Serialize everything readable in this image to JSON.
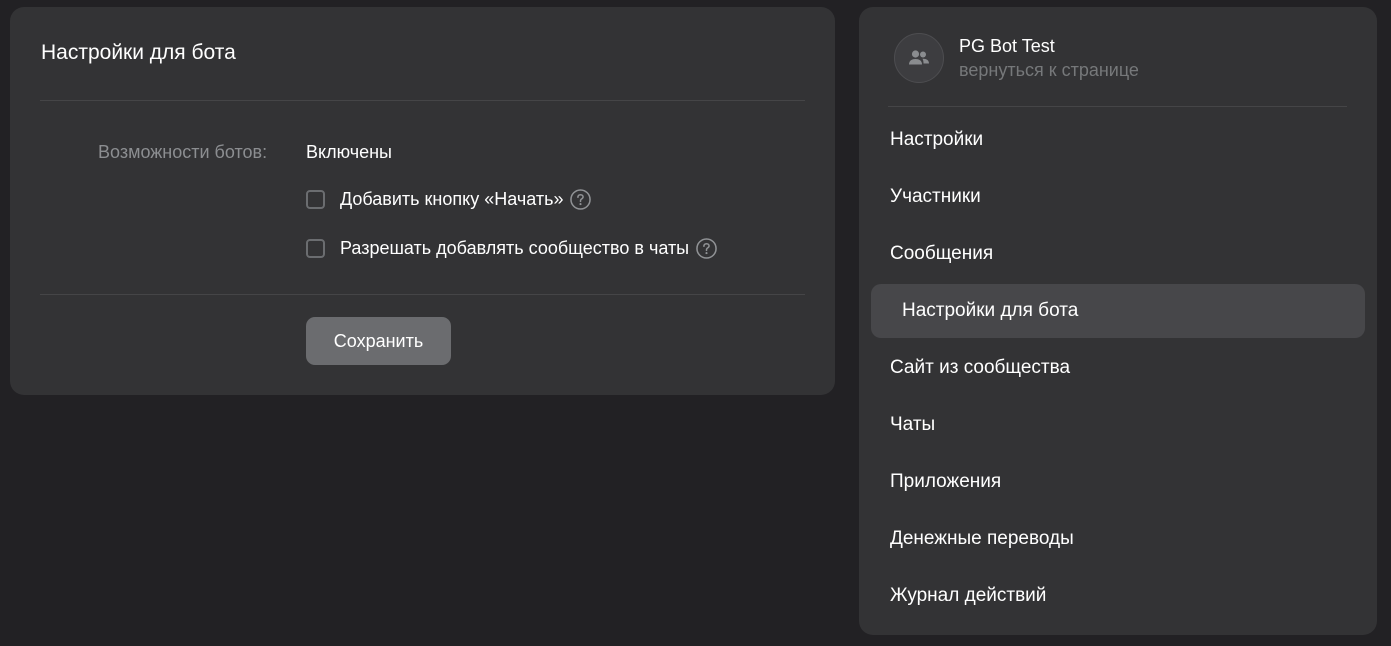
{
  "main": {
    "title": "Настройки для бота",
    "bot_features_label": "Возможности ботов:",
    "bot_features_value": "Включены",
    "checkboxes": [
      {
        "label": "Добавить кнопку «Начать»",
        "checked": false
      },
      {
        "label": "Разрешать добавлять сообщество в чаты",
        "checked": false
      }
    ],
    "save_label": "Сохранить"
  },
  "sidebar": {
    "group_name": "PG Bot Test",
    "back_link": "вернуться к странице",
    "items": [
      {
        "label": "Настройки",
        "active": false
      },
      {
        "label": "Участники",
        "active": false
      },
      {
        "label": "Сообщения",
        "active": false
      },
      {
        "label": "Настройки для бота",
        "active": true
      },
      {
        "label": "Сайт из сообщества",
        "active": false
      },
      {
        "label": "Чаты",
        "active": false
      },
      {
        "label": "Приложения",
        "active": false
      },
      {
        "label": "Денежные переводы",
        "active": false
      },
      {
        "label": "Журнал действий",
        "active": false
      }
    ]
  },
  "colors": {
    "background": "#222124",
    "card": "#333335",
    "active_item": "#47474a",
    "button": "#6b6c6f"
  },
  "icons": {
    "help": "question-circle-icon",
    "avatar": "group-users-icon"
  }
}
